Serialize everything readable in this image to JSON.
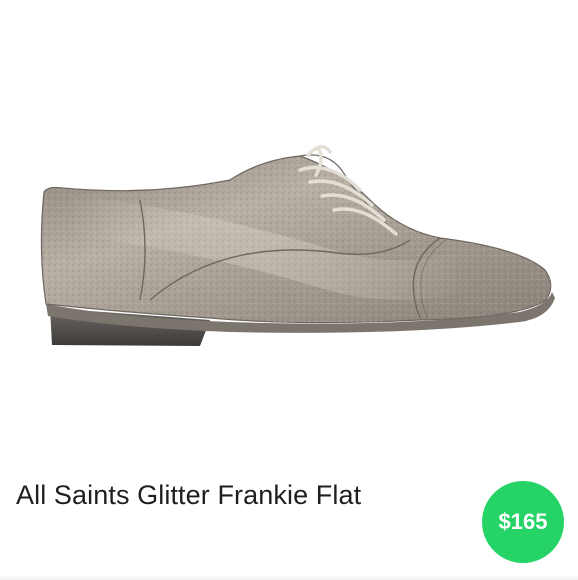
{
  "product": {
    "title": "All Saints Glitter Frankie Flat",
    "price": "$165",
    "image": "metallic-oxford-shoe",
    "price_badge_color": "#25d366"
  }
}
